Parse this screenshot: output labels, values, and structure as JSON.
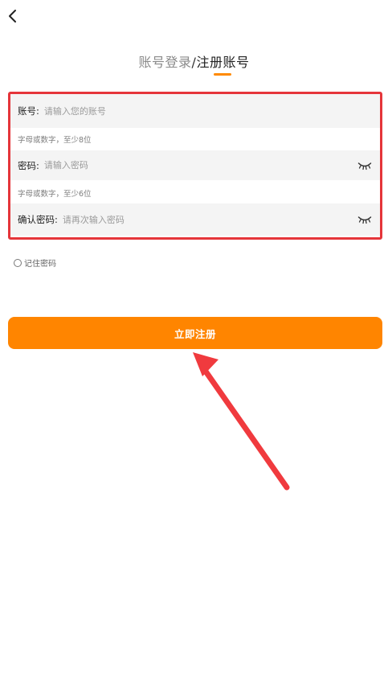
{
  "header": {
    "back_icon": "chevron-left-icon"
  },
  "tabs": {
    "login": "账号登录",
    "separator": "/",
    "register": "注册账号",
    "active_color": "#ff8a00"
  },
  "form": {
    "account": {
      "label": "账号",
      "colon": ":",
      "placeholder": "请输入您的账号",
      "value": "",
      "hint": "字母或数字，至少8位"
    },
    "password": {
      "label": "密码",
      "colon": ":",
      "placeholder": "请输入密码",
      "value": "",
      "hint": "字母或数字，至少6位",
      "toggle_icon": "eye-closed-icon"
    },
    "confirm_password": {
      "label": "确认密码",
      "colon": ":",
      "placeholder": "请再次输入密码",
      "value": "",
      "toggle_icon": "eye-closed-icon"
    },
    "highlight_color": "#e5353a"
  },
  "remember": {
    "label": "记住密码",
    "checked": false
  },
  "submit": {
    "label": "立即注册",
    "color": "#ff8500"
  },
  "annotation": {
    "arrow_color": "#f03a3e"
  }
}
